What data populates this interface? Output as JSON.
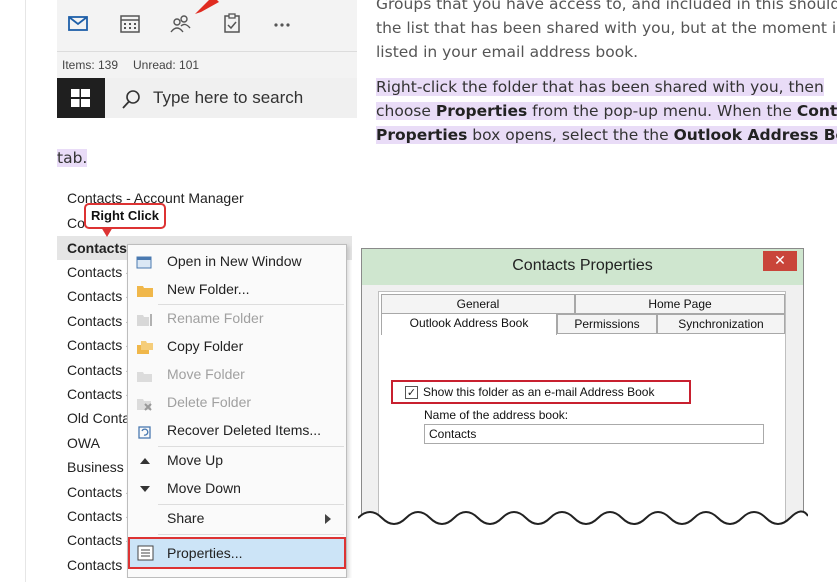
{
  "article": {
    "p1_lines": [
      "Groups that you have access to, and included in this should be",
      "the list that has been shared with you, but at the moment is not",
      "listed in your email address book."
    ],
    "p2": {
      "l1": "Right-click the folder that has been shared with you, then",
      "l2a": "choose ",
      "l2b": "Properties",
      "l2c": " from the pop-up menu. When the ",
      "l2d": "Contacts",
      "l3a": "Properties",
      "l3b": " box opens, select the the ",
      "l3c": "Outlook Address Book",
      "l4": "tab."
    }
  },
  "outlook": {
    "toolbar_icons": [
      "mail-icon",
      "calendar-icon",
      "people-icon",
      "tasks-icon",
      "more-icon"
    ],
    "status_items": "Items: 139",
    "status_unread": "Unread: 101",
    "search_placeholder": "Type here to search"
  },
  "folder_list": {
    "callout": "Right Click",
    "rows": [
      {
        "text": "Contacts - Account Manager",
        "style": "faded-tail"
      },
      {
        "text": "Co",
        "style": "normal"
      },
      {
        "text": "Contacts",
        "style": "bold"
      },
      {
        "text": "Contacts -",
        "style": "normal"
      },
      {
        "text": "Contacts -",
        "style": "normal"
      },
      {
        "text": "Contacts -",
        "style": "normal"
      },
      {
        "text": "Contacts -",
        "style": "normal"
      },
      {
        "text": "Contacts -",
        "style": "normal"
      },
      {
        "text": "Contacts -",
        "style": "normal"
      },
      {
        "text": "Old Conta",
        "style": "normal"
      },
      {
        "text": "OWA",
        "style": "normal"
      },
      {
        "text": "Business c",
        "style": "normal"
      },
      {
        "text": "Contacts -",
        "style": "normal"
      },
      {
        "text": "Contacts -",
        "style": "normal"
      },
      {
        "text": "Contacts -",
        "style": "normal"
      },
      {
        "text": "Contacts",
        "style": "normal"
      }
    ],
    "menu": [
      {
        "label": "Open in New Window",
        "icon": "open-window-icon",
        "disabled": false
      },
      {
        "label": "New Folder...",
        "icon": "new-folder-icon",
        "disabled": false
      },
      {
        "label": "Rename Folder",
        "icon": "rename-folder-icon",
        "disabled": true
      },
      {
        "label": "Copy Folder",
        "icon": "copy-folder-icon",
        "disabled": false
      },
      {
        "label": "Move Folder",
        "icon": "move-folder-icon",
        "disabled": true
      },
      {
        "label": "Delete Folder",
        "icon": "delete-folder-icon",
        "disabled": true
      },
      {
        "label": "Recover Deleted Items...",
        "icon": "recover-items-icon",
        "disabled": false
      },
      {
        "label": "Move Up",
        "icon": "arrow-up-icon",
        "disabled": false
      },
      {
        "label": "Move Down",
        "icon": "arrow-down-icon",
        "disabled": false
      },
      {
        "label": "Share",
        "icon": "",
        "disabled": false
      },
      {
        "label": "Properties...",
        "icon": "properties-icon",
        "disabled": false
      }
    ]
  },
  "dialog": {
    "title": "Contacts Properties",
    "close": "✕",
    "tabs_top": [
      "General",
      "Home Page"
    ],
    "tabs_bottom": [
      "Outlook Address Book",
      "Permissions",
      "Synchronization"
    ],
    "checkbox_label": "Show this folder as an e-mail Address Book",
    "checkbox_checked": true,
    "name_label": "Name of the address book:",
    "name_value": "Contacts"
  },
  "colors": {
    "highlight": "#e9dcf7",
    "callout_red": "#d33",
    "dialog_title_bg": "#cfe6cf",
    "selected_menu_bg": "#cce4f7"
  }
}
